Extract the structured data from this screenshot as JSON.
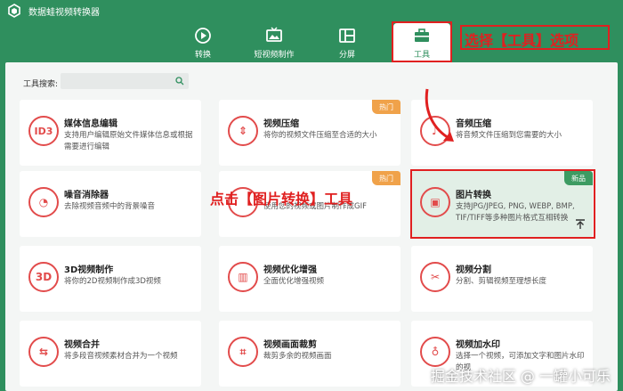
{
  "app": {
    "title": "数据蛙视频转换器"
  },
  "nav": [
    {
      "label": "转换",
      "icon": "convert-icon"
    },
    {
      "label": "短视频制作",
      "icon": "tv-icon"
    },
    {
      "label": "分屏",
      "icon": "split-screen-icon"
    },
    {
      "label": "工具",
      "icon": "toolbox-icon",
      "active": true
    }
  ],
  "annotations": {
    "select_tools": "选择【工具】选项",
    "click_image_convert": "点击【图片转换】工具"
  },
  "search": {
    "label": "工具搜索:",
    "placeholder": ""
  },
  "cards": [
    {
      "title": "媒体信息编辑",
      "desc": "支持用户编辑原始文件媒体信息或根据需要进行编辑",
      "icon_text": "ID3"
    },
    {
      "title": "视频压缩",
      "desc": "将你的视频文件压缩至合适的大小",
      "badge": "热门",
      "icon_text": "⇕"
    },
    {
      "title": "音频压缩",
      "desc": "将音频文件压缩到您需要的大小",
      "icon_text": "♪"
    },
    {
      "title": "噪音消除器",
      "desc": "去除视频音频中的背景噪音",
      "icon_text": "◔"
    },
    {
      "title": "",
      "desc": "使用您的视频或图片制作成GIF",
      "badge": "热门",
      "icon_text": ""
    },
    {
      "title": "图片转换",
      "desc": "支持JPG/JPEG, PNG, WEBP, BMP, TIF/TIFF等多种图片格式互相转换",
      "badge": "新品",
      "icon_text": "▣"
    },
    {
      "title": "3D视频制作",
      "desc": "将你的2D视频制作成3D视频",
      "icon_text": "3D"
    },
    {
      "title": "视频优化增强",
      "desc": "全面优化增强视频",
      "icon_text": "▥"
    },
    {
      "title": "视频分割",
      "desc": "分割、剪辑视频至理想长度",
      "icon_text": "✂"
    },
    {
      "title": "视频合并",
      "desc": "将多段音视频素材合并为一个视频",
      "icon_text": "⇆"
    },
    {
      "title": "视频画面裁剪",
      "desc": "裁剪多余的视频画面",
      "icon_text": "⌗"
    },
    {
      "title": "视频加水印",
      "desc": "选择一个视频，可添加文字和图片水印的视",
      "icon_text": "♁"
    }
  ],
  "watermark": "掘金技术社区 @ 一罐小可乐",
  "colors": {
    "brand": "#2f8f5e",
    "annotation": "#e02020",
    "hot_badge": "#f0a24a",
    "new_badge": "#3d9b62"
  }
}
